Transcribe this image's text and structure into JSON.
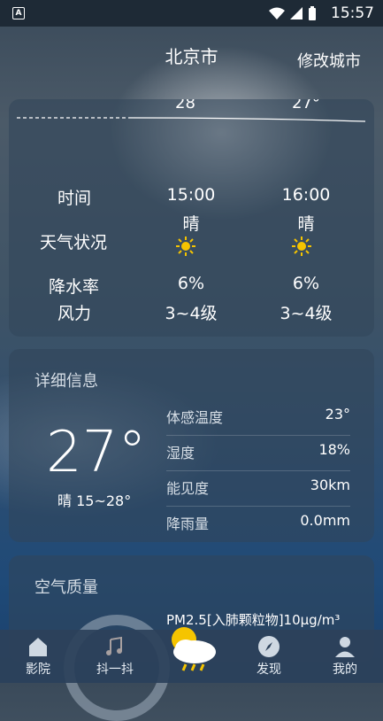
{
  "status_bar": {
    "time": "15:57"
  },
  "header": {
    "city": "北京市",
    "change_city": "修改城市"
  },
  "hourly": {
    "temps": [
      "28",
      "27°"
    ],
    "row_labels": {
      "time": "时间",
      "weather": "天气状况",
      "rain": "降水率",
      "wind": "风力"
    },
    "columns": [
      {
        "time": "15:00",
        "weather": "晴",
        "rain": "6%",
        "wind": "3~4级"
      },
      {
        "time": "16:00",
        "weather": "晴",
        "rain": "6%",
        "wind": "3~4级"
      }
    ]
  },
  "detail": {
    "title": "详细信息",
    "current_temp": "27°",
    "summary": "晴  15~28°",
    "rows": [
      {
        "label": "体感温度",
        "value": "23°"
      },
      {
        "label": "湿度",
        "value": "18%"
      },
      {
        "label": "能见度",
        "value": "30km"
      },
      {
        "label": "降雨量",
        "value": "0.0mm"
      }
    ]
  },
  "air": {
    "title": "空气质量",
    "pm25": "PM2.5[入肺颗粒物]10µg/m³"
  },
  "nav": {
    "items": [
      {
        "label": "影院",
        "icon": "cinema-icon"
      },
      {
        "label": "抖一抖",
        "icon": "music-note-icon"
      },
      {
        "label": "",
        "icon": "weather-cloud-sun-icon"
      },
      {
        "label": "发现",
        "icon": "compass-icon"
      },
      {
        "label": "我的",
        "icon": "user-icon"
      }
    ]
  },
  "colors": {
    "sun": "#f5c400",
    "accent_bg": "#1f4a78"
  }
}
